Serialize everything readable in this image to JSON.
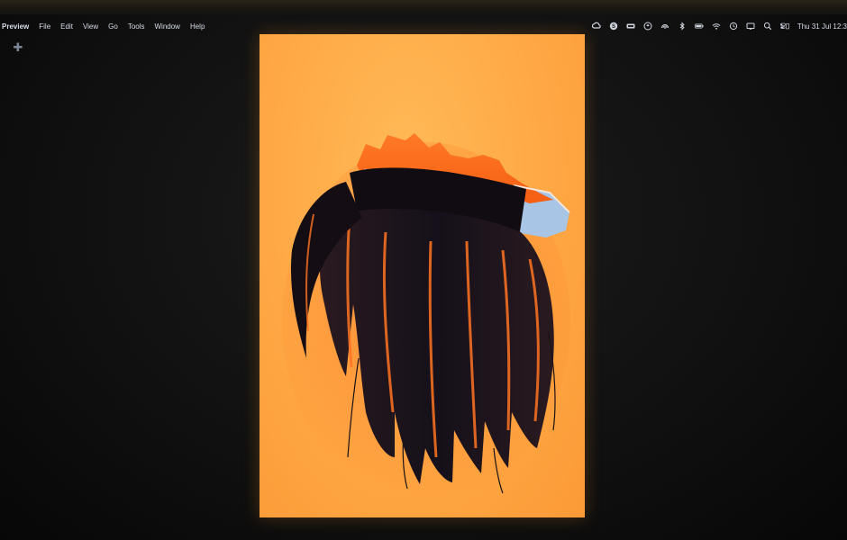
{
  "menubar": {
    "app_name": "Preview",
    "items": [
      {
        "id": "file",
        "label": "File"
      },
      {
        "id": "edit",
        "label": "Edit"
      },
      {
        "id": "view",
        "label": "View"
      },
      {
        "id": "go",
        "label": "Go"
      },
      {
        "id": "tools",
        "label": "Tools"
      },
      {
        "id": "window",
        "label": "Window"
      },
      {
        "id": "help",
        "label": "Help"
      }
    ],
    "status_icons": [
      "creative-cloud-icon",
      "skype-icon",
      "battery-box-icon",
      "dropbox-icon",
      "airdrop-icon",
      "bluetooth-icon",
      "battery-icon",
      "wifi-icon",
      "time-machine-icon",
      "spotlight-icon",
      "screen-mirroring-icon",
      "control-center-icon"
    ],
    "clock": "Thu 31 Jul  12:3"
  },
  "document": {
    "background_color": "#ffab48",
    "subject": "torn-paper-hair-artwork"
  },
  "colors": {
    "menu_text": "#d8dde8",
    "desktop": "#111111",
    "paper": "#ffab48",
    "torn_paper": "#fb6a1e",
    "hair": "#1a1418",
    "backing": "#a8c4e6"
  }
}
